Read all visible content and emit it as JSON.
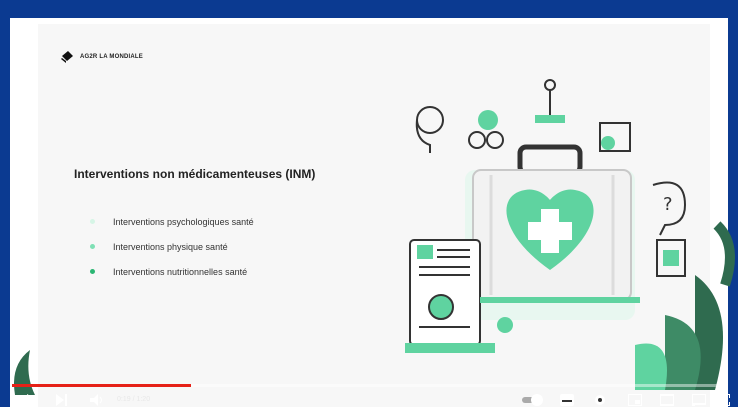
{
  "brand": {
    "name": "AG2R LA MONDIALE"
  },
  "slide": {
    "title": "Interventions non médicamenteuses (INM)",
    "bullets": [
      {
        "label": "Interventions psychologiques santé",
        "color": "#d6f5e6"
      },
      {
        "label": "Interventions physique santé",
        "color": "#7fe0b5"
      },
      {
        "label": "Interventions nutritionnelles santé",
        "color": "#2bb673"
      }
    ]
  },
  "player": {
    "time_display": "0:19 / 1:20",
    "progress": 0.25,
    "icons": [
      "play-icon",
      "next-icon",
      "volume-icon",
      "autoplay-icon",
      "subtitles-icon",
      "settings-icon",
      "miniplayer-icon",
      "theater-icon",
      "cast-icon",
      "fullscreen-icon"
    ]
  },
  "colors": {
    "accent": "#5fd3a0",
    "frame": "#0b3a91",
    "progress": "#e62117"
  }
}
